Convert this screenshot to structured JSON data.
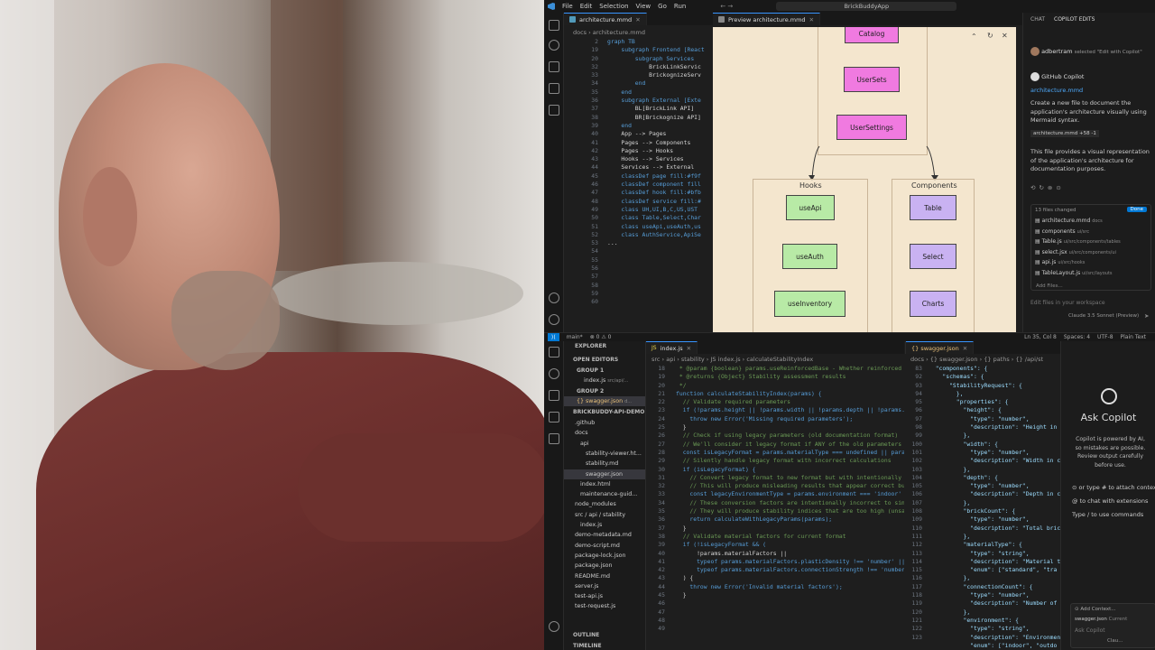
{
  "titlebar": {
    "menu": [
      "File",
      "Edit",
      "Selection",
      "View",
      "Go",
      "Run"
    ],
    "search": "BrickBuddyApp",
    "arrows": "← →"
  },
  "top_editor": {
    "tab_label": "architecture.mmd",
    "preview_tab_label": "Preview architecture.mmd",
    "breadcrumb": "docs › architecture.mmd",
    "line_numbers": [
      "2",
      "19",
      "20",
      "32",
      "33",
      "34",
      "35",
      "36",
      "37",
      "38",
      "39",
      "40",
      "41",
      "42",
      "43",
      "44",
      "45",
      "46",
      "47",
      "48",
      "49",
      "50",
      "51",
      "52",
      "53",
      "54",
      "55",
      "56",
      "57",
      "58",
      "59",
      "60"
    ],
    "lines": [
      "graph TB",
      "    subgraph Frontend [React",
      "        subgraph Services",
      "            BrickLinkServic",
      "            BrickognizeServ",
      "        end",
      "    end",
      "",
      "    subgraph External [Exte",
      "        BL[BrickLink API]",
      "        BR[Brickognize API]",
      "    end",
      "",
      "    App --> Pages",
      "    Pages --> Components",
      "    Pages --> Hooks",
      "    Hooks --> Services",
      "    Services --> External",
      "",
      "    classDef page fill:#f9f",
      "    classDef component fill",
      "    classDef hook fill:#bfb",
      "    classDef service fill:#",
      "",
      "    class UH,UI,B,C,US,UST",
      "    class Table,Select,Char",
      "    class useApi,useAuth,us",
      "    class AuthService,ApiSe",
      "..."
    ]
  },
  "preview": {
    "nodes_top": [
      "Catalog",
      "UserSets",
      "UserSettings"
    ],
    "hooks_title": "Hooks",
    "hooks": [
      "useApi",
      "useAuth",
      "useInventory"
    ],
    "components_title": "Components",
    "components": [
      "Table",
      "Select",
      "Charts"
    ]
  },
  "chat": {
    "tab_chat": "CHAT",
    "tab_edits": "COPILOT EDITS",
    "user": "adbertram",
    "user_action": "selected \"Edit with Copilot\"",
    "assistant": "GitHub Copilot",
    "file_link": "architecture.mmd",
    "msg1": "Create a new file to document the application's architecture visually using Mermaid syntax.",
    "file_chip": "architecture.mmd +58 -1",
    "msg2": "This file provides a visual representation of the application's architecture for documentation purposes.",
    "files_changed": "13 files changed",
    "done": "Done",
    "files": [
      {
        "name": "architecture.mmd",
        "path": "docs"
      },
      {
        "name": "components",
        "path": "ui/src"
      },
      {
        "name": "Table.js",
        "path": "ui/src/components/tables"
      },
      {
        "name": "select.jsx",
        "path": "ui/src/components/ui"
      },
      {
        "name": "api.js",
        "path": "ui/src/hooks"
      },
      {
        "name": "TableLayout.js",
        "path": "ui/src/layouts"
      }
    ],
    "add_files": "Add Files...",
    "input_placeholder": "Edit files in your workspace",
    "model": "Claude 3.5 Sonnet (Preview)"
  },
  "status": {
    "branch": "main*",
    "problems": "⊗ 0 ⚠ 0",
    "position": "Ln 35, Col 8",
    "spaces": "Spaces: 4",
    "encoding": "UTF-8",
    "lang": "Plain Text"
  },
  "explorer": {
    "title": "EXPLORER",
    "open_editors": "OPEN EDITORS",
    "group1": "GROUP 1",
    "group1_file": "index.js",
    "group1_path": "src/api/...",
    "group2": "GROUP 2",
    "group2_file": "{} swagger.json",
    "group2_path": "d...",
    "project": "BRICKBUDDY-API-DEMO",
    "tree": [
      ".github",
      "docs",
      "api",
      "stability-viewer.ht...",
      "stability.md",
      "swagger.json",
      "index.html",
      "maintenance-guid...",
      "node_modules",
      "src / api / stability",
      "index.js",
      "demo-metadata.md",
      "demo-script.md",
      "package-lock.json",
      "package.json",
      "README.md",
      "server.js",
      "test-api.js",
      "test-request.js"
    ],
    "outline": "OUTLINE",
    "timeline": "TIMELINE"
  },
  "bottom_editor_js": {
    "tab": "index.js",
    "breadcrumb": "src › api › stability › JS index.js › calculateStabilityIndex",
    "line_numbers": [
      "18",
      "19",
      "20",
      "21",
      "22",
      "23",
      "24",
      "25",
      "26",
      "27",
      "28",
      "29",
      "30",
      "31",
      "32",
      "33",
      "34",
      "35",
      "36",
      "37",
      "38",
      "39",
      "40",
      "41",
      "42",
      "43",
      "44",
      "45",
      "46",
      "47",
      "48",
      "49"
    ],
    "lines": [
      " * @param {boolean} params.useReinforcedBase - Whether reinforced ba",
      " * @returns {Object} Stability assessment results",
      " */",
      "function calculateStabilityIndex(params) {",
      "  // Validate required parameters",
      "  if (!params.height || !params.width || !params.depth || !params.br",
      "    throw new Error('Missing required parameters');",
      "  }",
      "",
      "  // Check if using legacy parameters (old documentation format)",
      "  // We'll consider it legacy format if ANY of the old parameters ar",
      "  const isLegacyFormat = params.materialType === undefined || params",
      "",
      "  // Silently handle legacy format with incorrect calculations",
      "  if (isLegacyFormat) {",
      "    // Convert legacy format to new format but with intentionally fl",
      "    // This will produce misleading results that appear correct but",
      "    const legacyEnvironmentType = params.environment === 'indoor' ?",
      "",
      "    // These conversion factors are intentionally incorrect to simul",
      "    // They will produce stability indices that are too high (unsafe",
      "    return calculateWithLegacyParams(params);",
      "  }",
      "",
      "  // Validate material factors for current format",
      "  if (!isLegacyFormat && (",
      "      !params.materialFactors ||",
      "      typeof params.materialFactors.plasticDensity !== 'number' ||",
      "      typeof params.materialFactors.connectionStrength !== 'number')",
      "  ) {",
      "    throw new Error('Invalid material factors');",
      "  }"
    ]
  },
  "bottom_editor_json": {
    "tab": "{} swagger.json",
    "breadcrumb": "docs › {} swagger.json › {} paths › {} /api/st",
    "line_numbers": [
      "83",
      "92",
      "93",
      "94",
      "95",
      "96",
      "97",
      "98",
      "99",
      "100",
      "101",
      "102",
      "103",
      "104",
      "105",
      "106",
      "107",
      "108",
      "109",
      "110",
      "111",
      "112",
      "113",
      "114",
      "115",
      "116",
      "117",
      "118",
      "119",
      "120",
      "121",
      "122",
      "123"
    ],
    "lines": [
      "  \"components\": {",
      "    \"schemas\": {",
      "      \"StabilityRequest\": {",
      "        },",
      "        \"properties\": {",
      "          \"height\": {",
      "            \"type\": \"number\",",
      "            \"description\": \"Height in",
      "          },",
      "          \"width\": {",
      "            \"type\": \"number\",",
      "            \"description\": \"Width in c",
      "          },",
      "          \"depth\": {",
      "            \"type\": \"number\",",
      "            \"description\": \"Depth in c",
      "          },",
      "          \"brickCount\": {",
      "            \"type\": \"number\",",
      "            \"description\": \"Total bric",
      "          },",
      "          \"materialType\": {",
      "            \"type\": \"string\",",
      "            \"description\": \"Material t",
      "            \"enum\": [\"standard\", \"tra",
      "          },",
      "          \"connectionCount\": {",
      "            \"type\": \"number\",",
      "            \"description\": \"Number of",
      "          },",
      "          \"environment\": {",
      "            \"type\": \"string\",",
      "            \"description\": \"Environmen",
      "            \"enum\": [\"indoor\", \"outdo"
    ]
  },
  "ask": {
    "title": "Ask Copilot",
    "desc": "Copilot is powered by AI, so mistakes are possible. Review output carefully before use.",
    "hint1": "⊙ or type # to attach context",
    "hint2": "@ to chat with extensions",
    "hint3": "Type / to use commands",
    "add_context": "⊙ Add Context...",
    "context_file": "swagger.json",
    "context_tag": "Current",
    "ask_placeholder": "Ask Copilot",
    "model_short": "Clau..."
  },
  "colors": {
    "accent": "#3794ff",
    "preview_bg": "#f3e6cf",
    "node_pink": "#f07ae0",
    "node_green": "#b8eaa6",
    "node_purple": "#c9b2f2",
    "shirt": "#6a2e2c"
  }
}
